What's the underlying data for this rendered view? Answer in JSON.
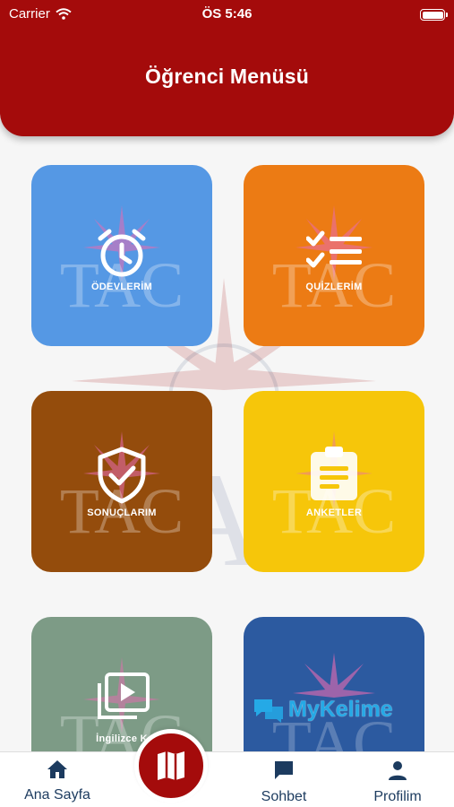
{
  "status_bar": {
    "carrier": "Carrier",
    "time": "ÖS 5:46"
  },
  "header": {
    "title": "Öğrenci Menüsü"
  },
  "tiles": [
    {
      "label": "ÖDEVLERİM",
      "icon": "alarm-clock-icon",
      "color": "#5598e4"
    },
    {
      "label": "QUİZLERİM",
      "icon": "checklist-icon",
      "color": "#ec7b14"
    },
    {
      "label": "SONUÇLARIM",
      "icon": "shield-check-icon",
      "color": "#944c0c"
    },
    {
      "label": "ANKETLER",
      "icon": "clipboard-icon",
      "color": "#f6c60a"
    },
    {
      "label": "İngilizce K",
      "icon": "video-library-icon",
      "color": "#7d9b86"
    },
    {
      "label": "MyKelime",
      "icon": "chat-bubbles-icon",
      "color": "#2c5aa0"
    }
  ],
  "watermark": {
    "text": "TAC"
  },
  "bottom_nav": {
    "home": "Ana Sayfa",
    "chat": "Sohbet",
    "profile": "Profilim",
    "center_icon": "map-icon"
  }
}
